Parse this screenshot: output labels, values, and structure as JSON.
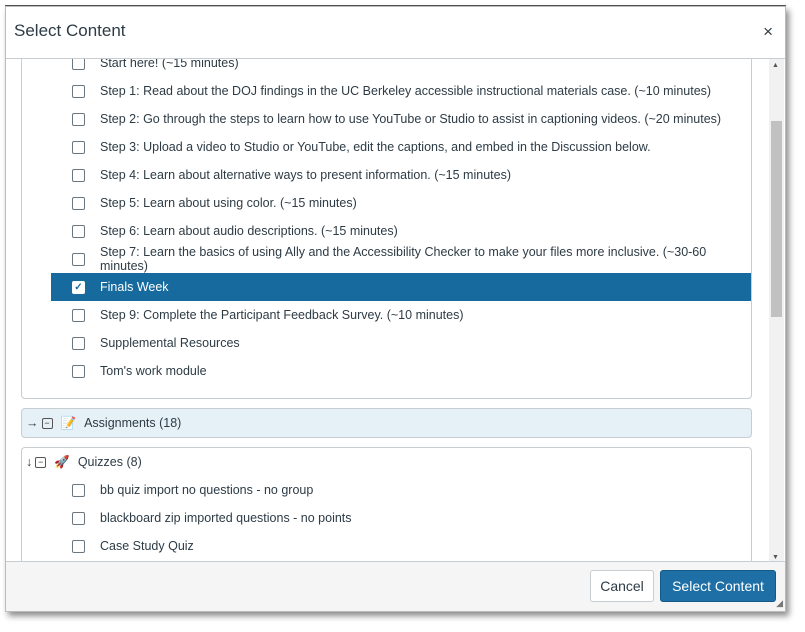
{
  "dialog": {
    "title": "Select Content",
    "close": "×"
  },
  "modules": [
    {
      "label": "Start here! (~15 minutes)",
      "checked": false
    },
    {
      "label": "Step 1: Read about the DOJ findings in the UC Berkeley accessible instructional materials case. (~10 minutes)",
      "checked": false
    },
    {
      "label": "Step 2: Go through the steps to learn how to use YouTube or Studio to assist in captioning videos. (~20 minutes)",
      "checked": false
    },
    {
      "label": "Step 3: Upload a video to Studio or YouTube, edit the captions, and embed in the Discussion below.",
      "checked": false
    },
    {
      "label": "Step 4: Learn about alternative ways to present information. (~15 minutes)",
      "checked": false
    },
    {
      "label": "Step 5: Learn about using color. (~15 minutes)",
      "checked": false
    },
    {
      "label": "Step 6: Learn about audio descriptions. (~15 minutes)",
      "checked": false
    },
    {
      "label": "Step 7: Learn the basics of using Ally and the Accessibility Checker to make your files more inclusive. (~30-60 minutes)",
      "checked": false
    },
    {
      "label": "Finals Week",
      "checked": true
    },
    {
      "label": "Step 9: Complete the Participant Feedback Survey. (~10 minutes)",
      "checked": false
    },
    {
      "label": "Supplemental Resources",
      "checked": false
    },
    {
      "label": "Tom's work module",
      "checked": false
    }
  ],
  "assignments": {
    "label": "Assignments (18)",
    "arrow": "→",
    "icon": "assignment-icon"
  },
  "quizzes": {
    "label": "Quizzes (8)",
    "arrow": "↓",
    "icon": "rocket-icon",
    "items": [
      {
        "label": "bb quiz import no questions - no group"
      },
      {
        "label": "blackboard zip imported questions - no points"
      },
      {
        "label": "Case Study Quiz"
      }
    ]
  },
  "footer": {
    "cancel": "Cancel",
    "submit": "Select Content"
  },
  "colors": {
    "accent": "#1d6fa5",
    "selected_row": "#166a9e",
    "section_bg": "#e6f0f7"
  }
}
